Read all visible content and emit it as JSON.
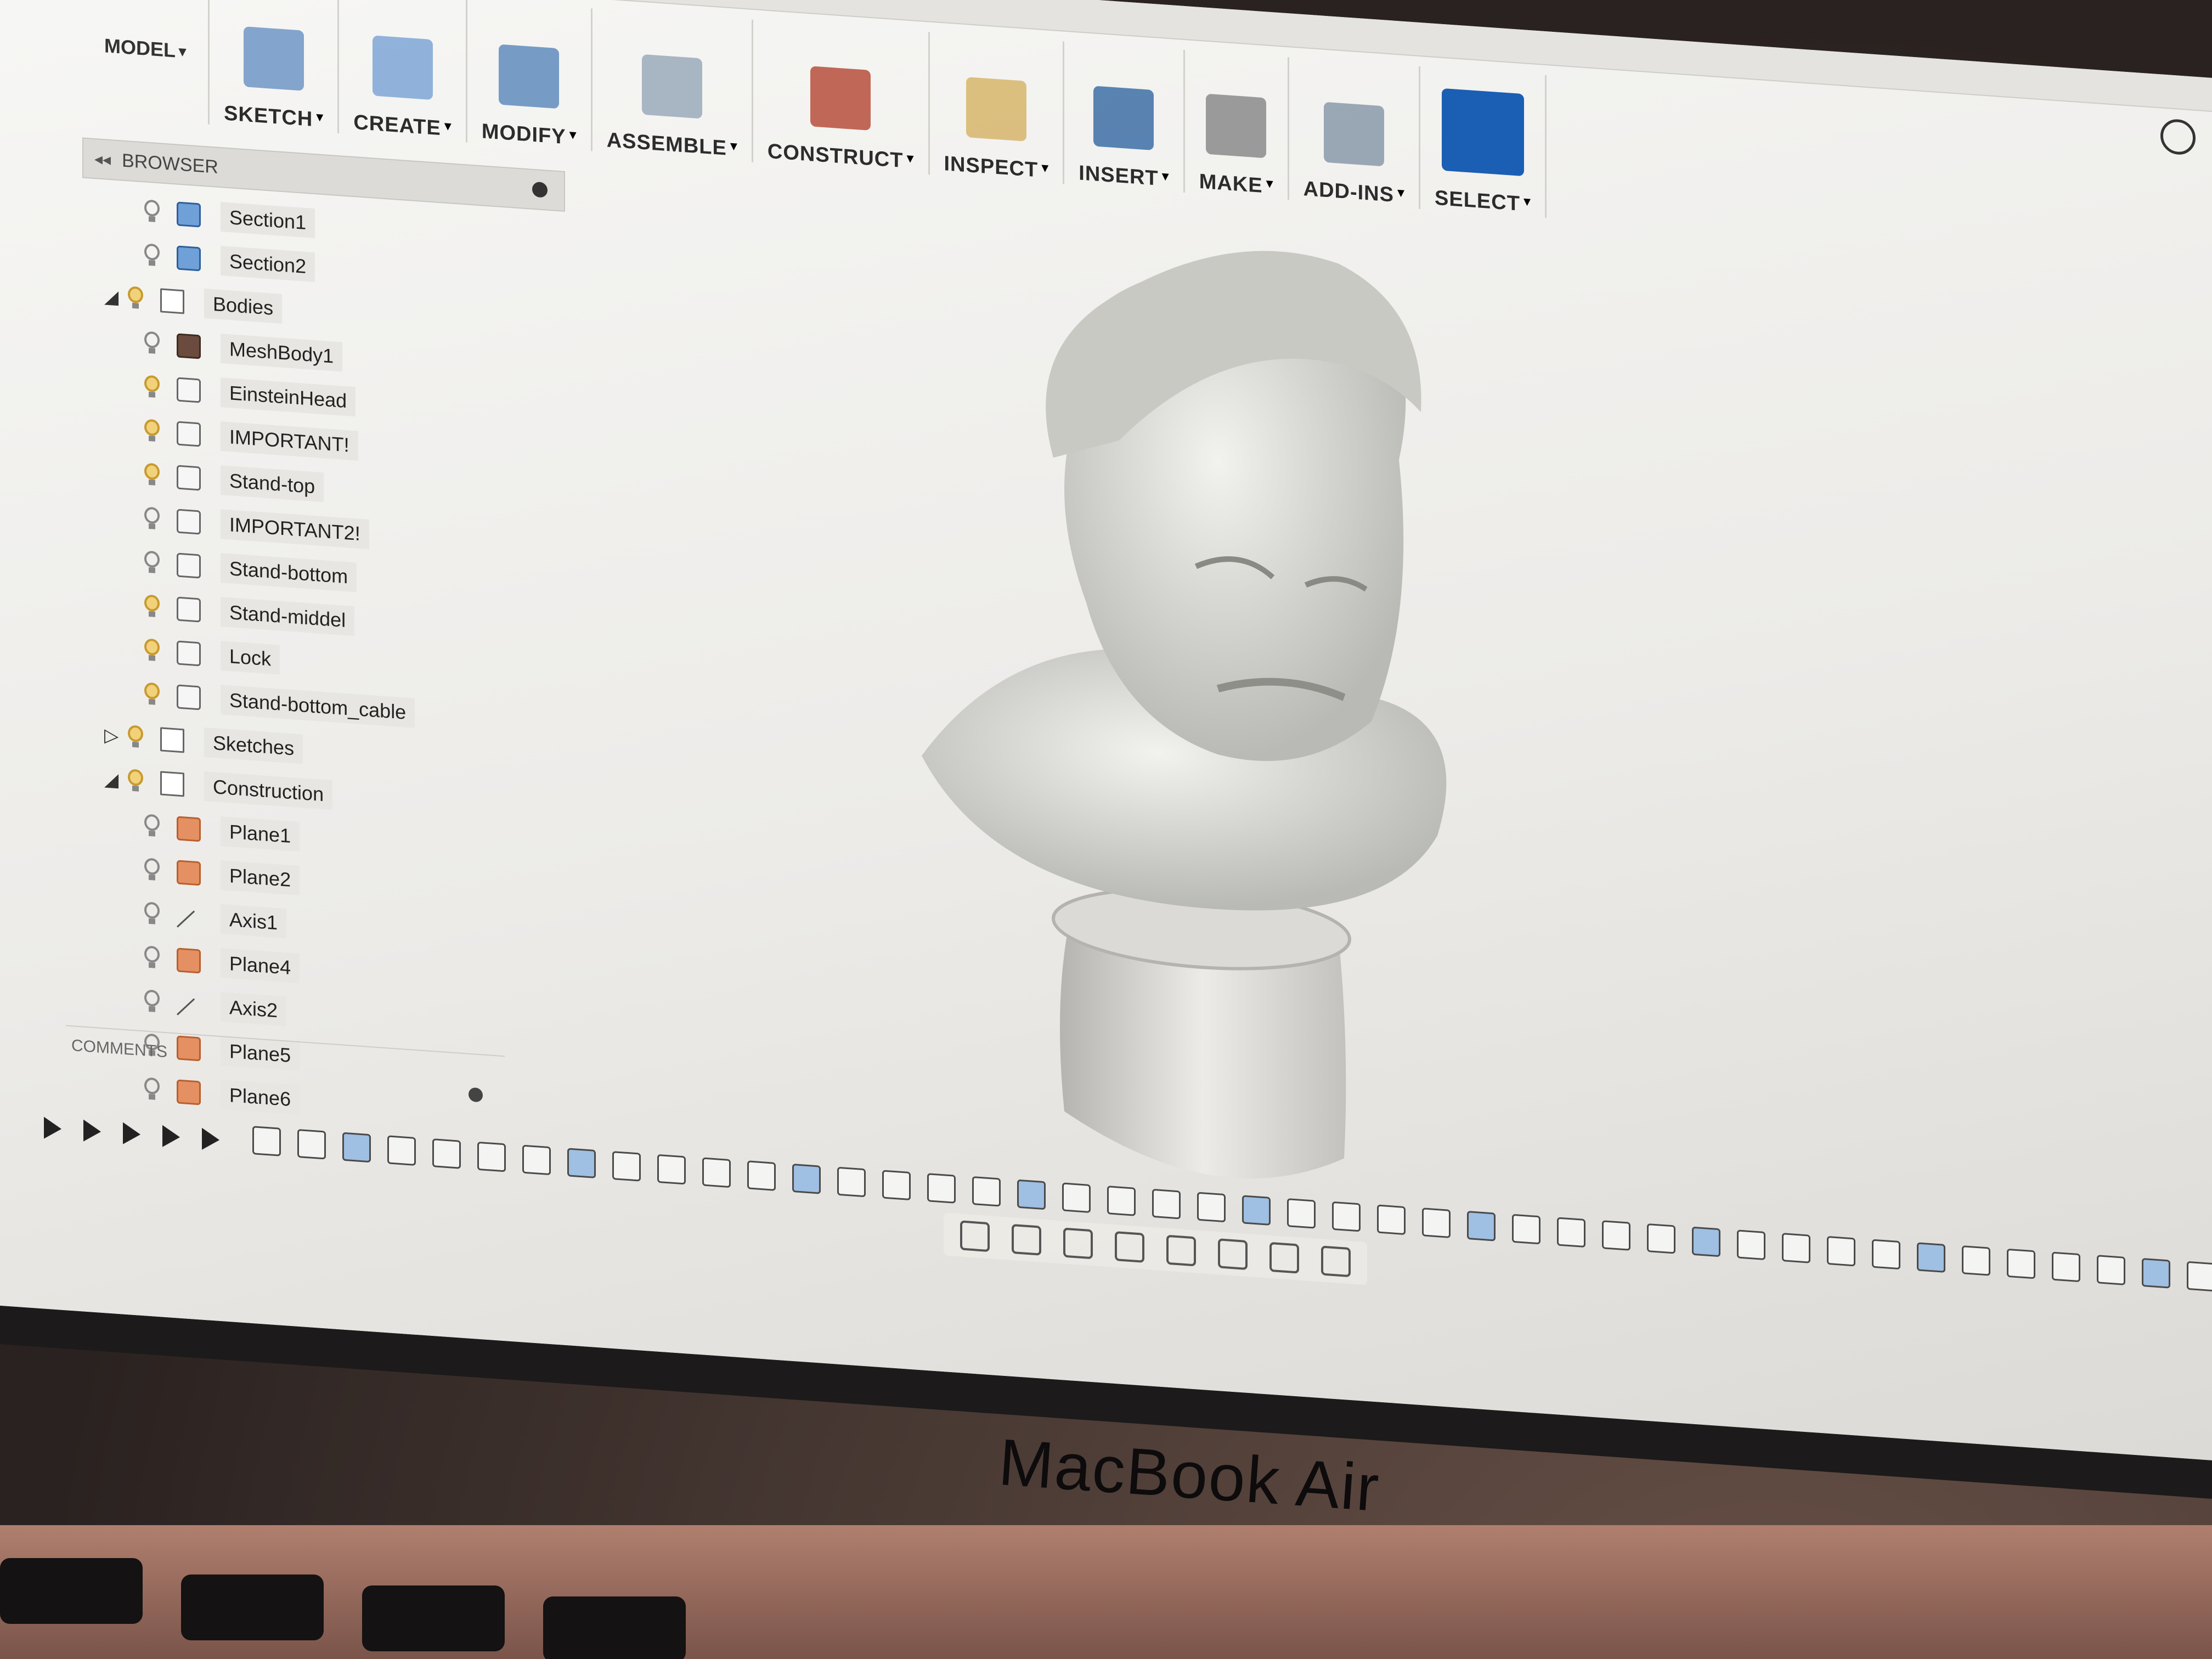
{
  "toolbar": {
    "workspace": "MODEL",
    "groups": [
      {
        "label": "SKETCH",
        "icon": "sketch-icon"
      },
      {
        "label": "CREATE",
        "icon": "create-icon"
      },
      {
        "label": "MODIFY",
        "icon": "modify-icon"
      },
      {
        "label": "ASSEMBLE",
        "icon": "assemble-icon"
      },
      {
        "label": "CONSTRUCT",
        "icon": "construct-icon"
      },
      {
        "label": "INSPECT",
        "icon": "inspect-icon"
      },
      {
        "label": "INSERT",
        "icon": "insert-icon"
      },
      {
        "label": "MAKE",
        "icon": "make-icon"
      },
      {
        "label": "ADD-INS",
        "icon": "add-ins-icon"
      },
      {
        "label": "SELECT",
        "icon": "select-icon"
      }
    ],
    "accent": "#1a5fb4"
  },
  "browser": {
    "title": "BROWSER",
    "items": [
      {
        "label": "Section1",
        "type": "section",
        "level": 2,
        "visible": false
      },
      {
        "label": "Section2",
        "type": "section",
        "level": 2,
        "visible": false
      },
      {
        "label": "Bodies",
        "type": "folder",
        "level": 1,
        "visible": true,
        "expanded": true
      },
      {
        "label": "MeshBody1",
        "type": "mesh",
        "level": 2,
        "visible": false
      },
      {
        "label": "EinsteinHead",
        "type": "body",
        "level": 2,
        "visible": true
      },
      {
        "label": "IMPORTANT!",
        "type": "body",
        "level": 2,
        "visible": true
      },
      {
        "label": "Stand-top",
        "type": "body",
        "level": 2,
        "visible": true
      },
      {
        "label": "IMPORTANT2!",
        "type": "body",
        "level": 2,
        "visible": false
      },
      {
        "label": "Stand-bottom",
        "type": "body",
        "level": 2,
        "visible": false
      },
      {
        "label": "Stand-middel",
        "type": "body",
        "level": 2,
        "visible": true
      },
      {
        "label": "Lock",
        "type": "body",
        "level": 2,
        "visible": true
      },
      {
        "label": "Stand-bottom_cable",
        "type": "body",
        "level": 2,
        "visible": true
      },
      {
        "label": "Sketches",
        "type": "folder",
        "level": 1,
        "visible": true,
        "expanded": false
      },
      {
        "label": "Construction",
        "type": "folder",
        "level": 1,
        "visible": true,
        "expanded": true
      },
      {
        "label": "Plane1",
        "type": "plane",
        "level": 2,
        "visible": false
      },
      {
        "label": "Plane2",
        "type": "plane",
        "level": 2,
        "visible": false
      },
      {
        "label": "Axis1",
        "type": "axis",
        "level": 2,
        "visible": false
      },
      {
        "label": "Plane4",
        "type": "plane",
        "level": 2,
        "visible": false
      },
      {
        "label": "Axis2",
        "type": "axis",
        "level": 2,
        "visible": false
      },
      {
        "label": "Plane5",
        "type": "plane",
        "level": 2,
        "visible": false
      },
      {
        "label": "Plane6",
        "type": "plane",
        "level": 2,
        "visible": false
      }
    ]
  },
  "comments": {
    "title": "COMMENTS"
  },
  "laptop": {
    "label": "MacBook Air"
  }
}
